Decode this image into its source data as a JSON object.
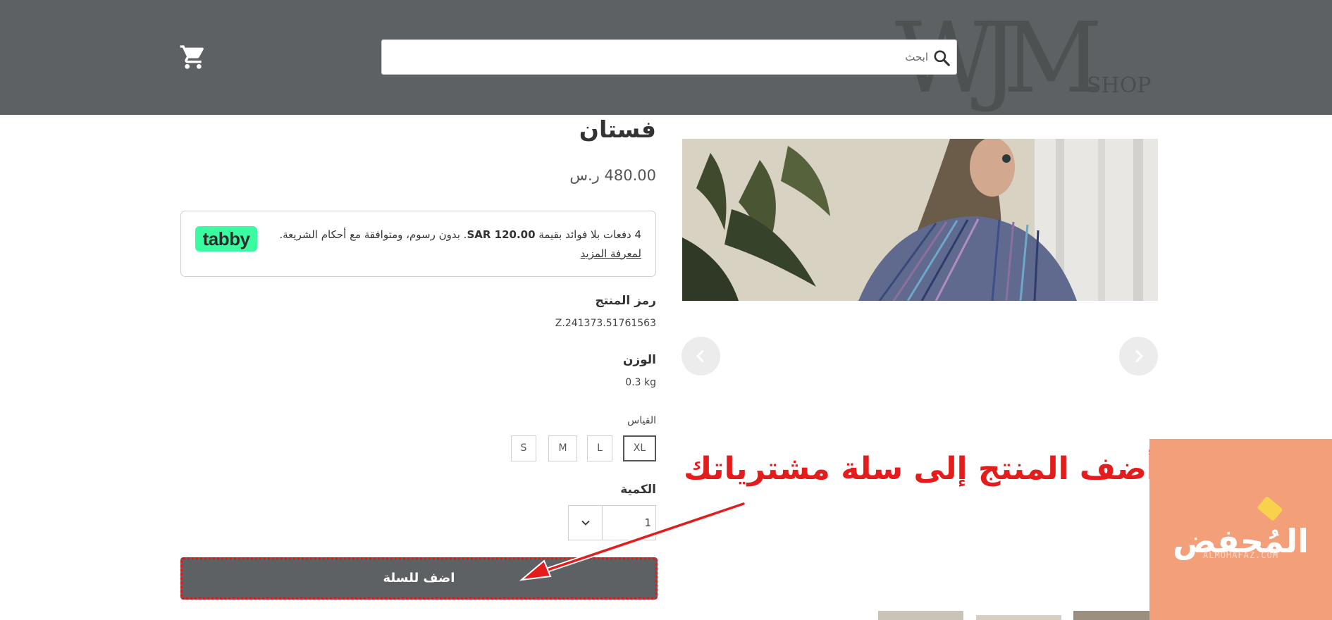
{
  "header": {
    "logo_mark": "WJM",
    "logo_sub": "SHOP",
    "search_placeholder": "ابحث",
    "search_icon": "search-icon",
    "cart_icon": "cart-icon"
  },
  "product": {
    "title": "فستان",
    "price": "480.00 ر.س",
    "tabby": {
      "text_prefix": "4 دفعات بلا فوائد بقيمة",
      "amount": "SAR 120.00",
      "text_suffix": ". بدون رسوم، ومتوافقة مع أحكام الشريعة.",
      "learn_more": "لمعرفة المزيد",
      "badge": "tabby"
    },
    "sku_label": "رمز المنتج",
    "sku_value": "Z.241373.51761563",
    "weight_label": "الوزن",
    "weight_value": "0.3 kg",
    "size_label": "القياس",
    "sizes": [
      "XL",
      "L",
      "M",
      "S"
    ],
    "selected_size": "XL",
    "qty_label": "الكمية",
    "qty_value": "1",
    "add_to_cart": "اضف للسلة"
  },
  "gallery": {
    "prev_icon": "chevron-left-icon",
    "next_icon": "chevron-right-icon",
    "thumbnail_count": 3
  },
  "annotation": {
    "text": "أضف المنتج إلى سلة مشترياتك",
    "color": "#e51c1c"
  },
  "watermark": {
    "text": "المُحفض",
    "sub": "ALMOHAFAZ.COM",
    "bg_color": "#f3a07a"
  },
  "colors": {
    "header_bg": "#5e6163",
    "button_bg": "#5e6163",
    "tabby_green": "#3bfba0"
  }
}
